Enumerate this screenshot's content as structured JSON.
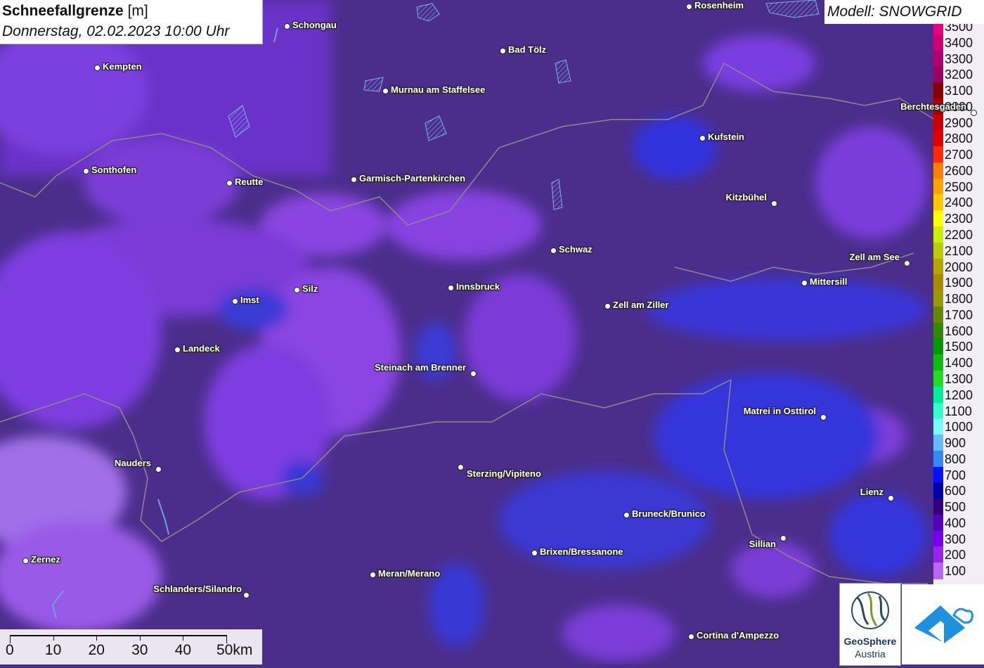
{
  "title": {
    "main": "Schneefallgrenze",
    "unit": "[m]",
    "date": "Donnerstag, 02.02.2023 10:00 Uhr"
  },
  "model": {
    "label": "Modell: SNOWGRID"
  },
  "legend": [
    {
      "value": "3500",
      "color": "#e8007e"
    },
    {
      "value": "3400",
      "color": "#cc0077"
    },
    {
      "value": "3300",
      "color": "#b00070"
    },
    {
      "value": "3200",
      "color": "#990066"
    },
    {
      "value": "3100",
      "color": "#880000"
    },
    {
      "value": "3000",
      "color": "#aa0000"
    },
    {
      "value": "2900",
      "color": "#cc0000"
    },
    {
      "value": "2800",
      "color": "#e20000"
    },
    {
      "value": "2700",
      "color": "#ff2a00"
    },
    {
      "value": "2600",
      "color": "#ff7f00"
    },
    {
      "value": "2500",
      "color": "#ffa200"
    },
    {
      "value": "2400",
      "color": "#ffc800"
    },
    {
      "value": "2300",
      "color": "#ffff00"
    },
    {
      "value": "2200",
      "color": "#ccee00"
    },
    {
      "value": "2100",
      "color": "#bbcc00"
    },
    {
      "value": "2000",
      "color": "#b3a600"
    },
    {
      "value": "1900",
      "color": "#a88a00"
    },
    {
      "value": "1800",
      "color": "#999900"
    },
    {
      "value": "1700",
      "color": "#668800"
    },
    {
      "value": "1600",
      "color": "#338800"
    },
    {
      "value": "1500",
      "color": "#009900"
    },
    {
      "value": "1400",
      "color": "#11bb11"
    },
    {
      "value": "1300",
      "color": "#22dd22"
    },
    {
      "value": "1200",
      "color": "#00ee99"
    },
    {
      "value": "1100",
      "color": "#33ffcc"
    },
    {
      "value": "1000",
      "color": "#77ffff"
    },
    {
      "value": "900",
      "color": "#66bbff"
    },
    {
      "value": "800",
      "color": "#3388ff"
    },
    {
      "value": "700",
      "color": "#0011ff"
    },
    {
      "value": "600",
      "color": "#0000aa"
    },
    {
      "value": "500",
      "color": "#330077"
    },
    {
      "value": "400",
      "color": "#5500bb"
    },
    {
      "value": "300",
      "color": "#7700ee"
    },
    {
      "value": "200",
      "color": "#9922ee"
    },
    {
      "value": "100",
      "color": "#bb66ee"
    }
  ],
  "cities": [
    {
      "name": "Schongau"
    },
    {
      "name": "Rosenheim"
    },
    {
      "name": "Kempten"
    },
    {
      "name": "Bad Tölz"
    },
    {
      "name": "Murnau am Staffelsee"
    },
    {
      "name": "Berchtesgaden"
    },
    {
      "name": "Kufstein"
    },
    {
      "name": "Sonthofen"
    },
    {
      "name": "Reutte"
    },
    {
      "name": "Garmisch-Partenkirchen"
    },
    {
      "name": "Kitzbühel"
    },
    {
      "name": "Schwaz"
    },
    {
      "name": "Zell am See"
    },
    {
      "name": "Innsbruck"
    },
    {
      "name": "Silz"
    },
    {
      "name": "Imst"
    },
    {
      "name": "Mittersill"
    },
    {
      "name": "Zell am Ziller"
    },
    {
      "name": "Landeck"
    },
    {
      "name": "Steinach am Brenner"
    },
    {
      "name": "Matrei in Osttirol"
    },
    {
      "name": "Nauders"
    },
    {
      "name": "Sterzing/Vipiteno"
    },
    {
      "name": "Lienz"
    },
    {
      "name": "Bruneck/Brunico"
    },
    {
      "name": "Sillian"
    },
    {
      "name": "Brixen/Bressanone"
    },
    {
      "name": "Zernez"
    },
    {
      "name": "Meran/Merano"
    },
    {
      "name": "Schlanders/Silandro"
    },
    {
      "name": "Cortina d'Ampezzo"
    }
  ],
  "scale": {
    "labels": [
      "0",
      "10",
      "20",
      "30",
      "40",
      "50km"
    ]
  },
  "logo": {
    "name": "GeoSphere",
    "sub": "Austria"
  }
}
